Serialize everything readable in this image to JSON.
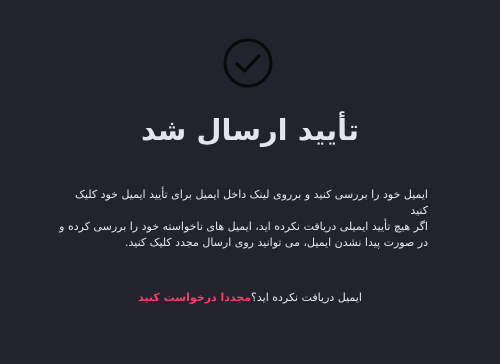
{
  "icons": {
    "success": "check-circle-icon"
  },
  "colors": {
    "background": "#23232e",
    "text": "#e8e8ee",
    "link": "#ff3a6a"
  },
  "confirmation": {
    "title": "تأیید ارسال شد",
    "instruction": "ایمیل خود را بررسی کنید و برروی لینک داخل ایمیل برای تأیید ایمیل خود کلیک کنید",
    "help": "اگر هیچ تأیید ایمیلی دریافت نکرده اید، ایمیل های ناخواسته خود را بررسی کرده و در صورت پیدا نشدن ایمیل، می توانید روی ارسال مجدد کلیک کنید.",
    "not_received": "ایمیل دریافت نکرده اید؟",
    "resend_label": "مجددا درخواست کنید"
  }
}
